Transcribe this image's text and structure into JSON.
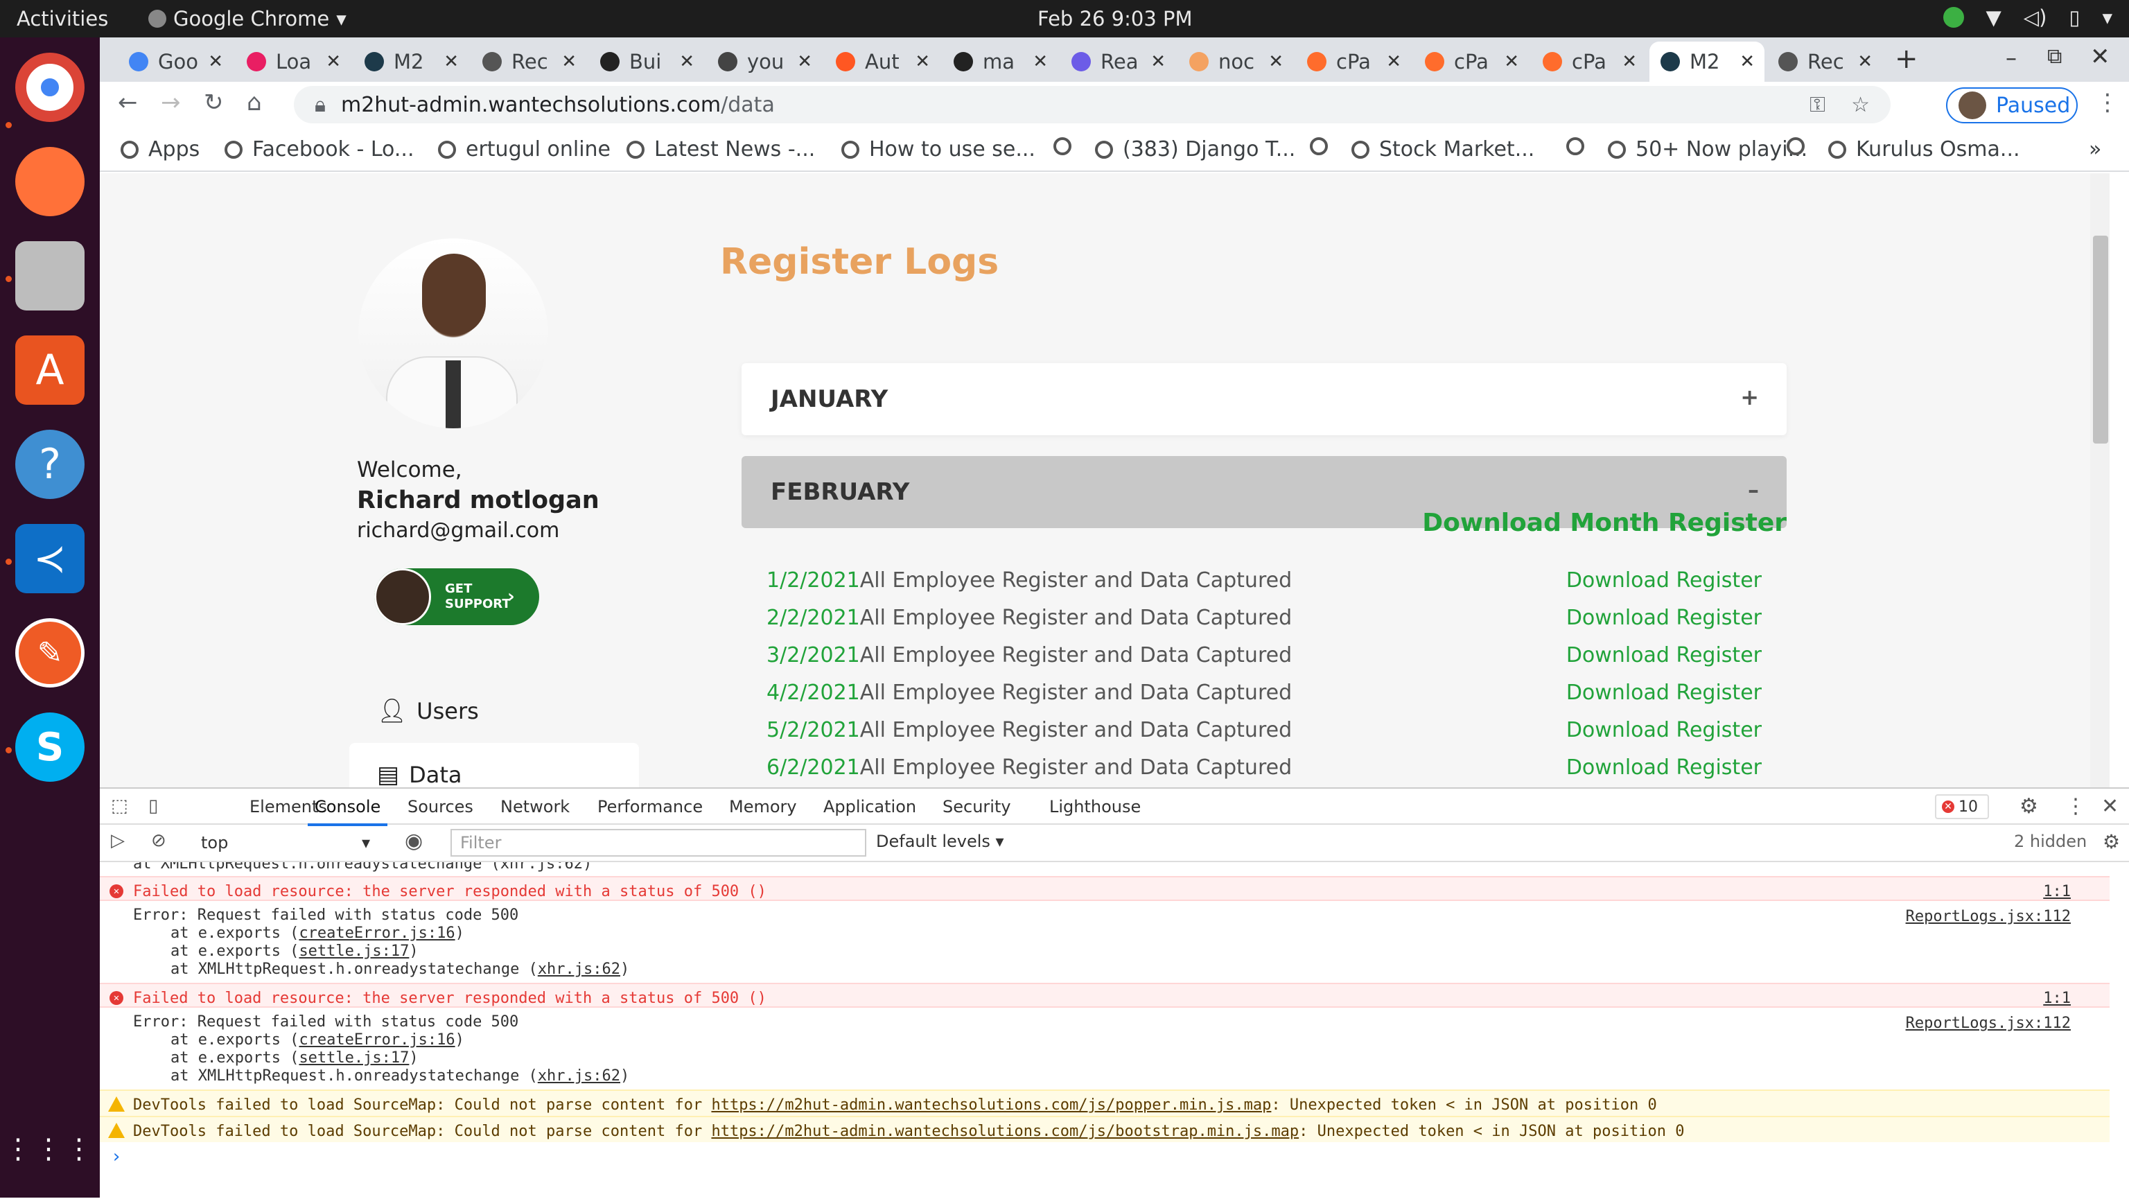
{
  "system": {
    "activities": "Activities",
    "app_name": "Google Chrome",
    "clock": "Feb 26   9:03 PM"
  },
  "browser": {
    "tabs": [
      {
        "label": "Goo",
        "color": "#4285f4"
      },
      {
        "label": "Loa",
        "color": "#e91e63"
      },
      {
        "label": "M2",
        "color": "#1d3a4a"
      },
      {
        "label": "Rec",
        "color": "#555555"
      },
      {
        "label": "Bui",
        "color": "#222222"
      },
      {
        "label": "you",
        "color": "#444444"
      },
      {
        "label": "Aut",
        "color": "#ff5722"
      },
      {
        "label": "ma",
        "color": "#222222"
      },
      {
        "label": "Rea",
        "color": "#6c5ce7"
      },
      {
        "label": "noc",
        "color": "#f4a261"
      },
      {
        "label": "cPa",
        "color": "#ff6c2c"
      },
      {
        "label": "cPa",
        "color": "#ff6c2c"
      },
      {
        "label": "cPa",
        "color": "#ff6c2c"
      },
      {
        "label": "M2",
        "color": "#1d3a4a"
      },
      {
        "label": "Rec",
        "color": "#555555"
      }
    ],
    "active_tab_index": 13,
    "url_host": "m2hut-admin.wantechsolutions.com",
    "url_path": "/data",
    "profile_label": "Paused",
    "bookmarks": [
      {
        "label": "Apps"
      },
      {
        "label": "Facebook - Lo..."
      },
      {
        "label": "ertugul online"
      },
      {
        "label": "Latest News -..."
      },
      {
        "label": "How to use se..."
      },
      {
        "label": ""
      },
      {
        "label": "(383) Django T..."
      },
      {
        "label": ""
      },
      {
        "label": "Stock Market..."
      },
      {
        "label": ""
      },
      {
        "label": "50+ Now playi..."
      },
      {
        "label": ""
      },
      {
        "label": "Kurulus Osma..."
      }
    ],
    "more": "»"
  },
  "sidebar": {
    "welcome": "Welcome,",
    "name": "Richard motlogan",
    "email": "richard@gmail.com",
    "support_label": "GET SUPPORT",
    "menu": [
      {
        "label": "Users"
      },
      {
        "label": "Data"
      }
    ]
  },
  "main": {
    "title": "Register Logs",
    "months": [
      {
        "label": "JANUARY",
        "sign": "+",
        "expanded": false
      },
      {
        "label": "FEBRUARY",
        "sign": "–",
        "expanded": true
      }
    ],
    "download_month": "Download Month Register",
    "rows": [
      {
        "date": "1/2/2021",
        "desc": "All Employee Register and Data Captured",
        "link": "Download Register"
      },
      {
        "date": "2/2/2021",
        "desc": "All Employee Register and Data Captured",
        "link": "Download Register"
      },
      {
        "date": "3/2/2021",
        "desc": "All Employee Register and Data Captured",
        "link": "Download Register"
      },
      {
        "date": "4/2/2021",
        "desc": "All Employee Register and Data Captured",
        "link": "Download Register"
      },
      {
        "date": "5/2/2021",
        "desc": "All Employee Register and Data Captured",
        "link": "Download Register"
      },
      {
        "date": "6/2/2021",
        "desc": "All Employee Register and Data Captured",
        "link": "Download Register"
      }
    ]
  },
  "devtools": {
    "tabs": [
      "Elements",
      "Console",
      "Sources",
      "Network",
      "Performance",
      "Memory",
      "Application",
      "Security",
      "Lighthouse"
    ],
    "active_tab": "Console",
    "error_count": "10",
    "context": "top",
    "filter_placeholder": "Filter",
    "levels": "Default levels ▾",
    "hidden": "2 hidden",
    "console": {
      "partial_line": "at XMLHttpRequest.h.onreadystatechange (xhr.js:62)",
      "errors": [
        {
          "message": "Failed to load resource: the server responded with a status of 500 ()",
          "source": "1:1",
          "stack_head": "Error: Request failed with status code 500",
          "stack_source": "ReportLogs.jsx:112",
          "stack": [
            {
              "text": "at e.exports (",
              "link": "createError.js:16",
              "end": ")"
            },
            {
              "text": "at e.exports (",
              "link": "settle.js:17",
              "end": ")"
            },
            {
              "text": "at XMLHttpRequest.h.onreadystatechange (",
              "link": "xhr.js:62",
              "end": ")"
            }
          ]
        },
        {
          "message": "Failed to load resource: the server responded with a status of 500 ()",
          "source": "1:1",
          "stack_head": "Error: Request failed with status code 500",
          "stack_source": "ReportLogs.jsx:112",
          "stack": [
            {
              "text": "at e.exports (",
              "link": "createError.js:16",
              "end": ")"
            },
            {
              "text": "at e.exports (",
              "link": "settle.js:17",
              "end": ")"
            },
            {
              "text": "at XMLHttpRequest.h.onreadystatechange (",
              "link": "xhr.js:62",
              "end": ")"
            }
          ]
        }
      ],
      "warnings": [
        {
          "pre": "DevTools failed to load SourceMap: Could not parse content for ",
          "link": "https://m2hut-admin.wantechsolutions.com/js/popper.min.js.map",
          "post": ": Unexpected token < in JSON at position 0"
        },
        {
          "pre": "DevTools failed to load SourceMap: Could not parse content for ",
          "link": "https://m2hut-admin.wantechsolutions.com/js/bootstrap.min.js.map",
          "post": ": Unexpected token < in JSON at position 0"
        }
      ],
      "prompt": "›"
    }
  },
  "colors": {
    "accent_orange": "#e8a25f",
    "link_green": "#21a33a",
    "error_red": "#e53935"
  }
}
